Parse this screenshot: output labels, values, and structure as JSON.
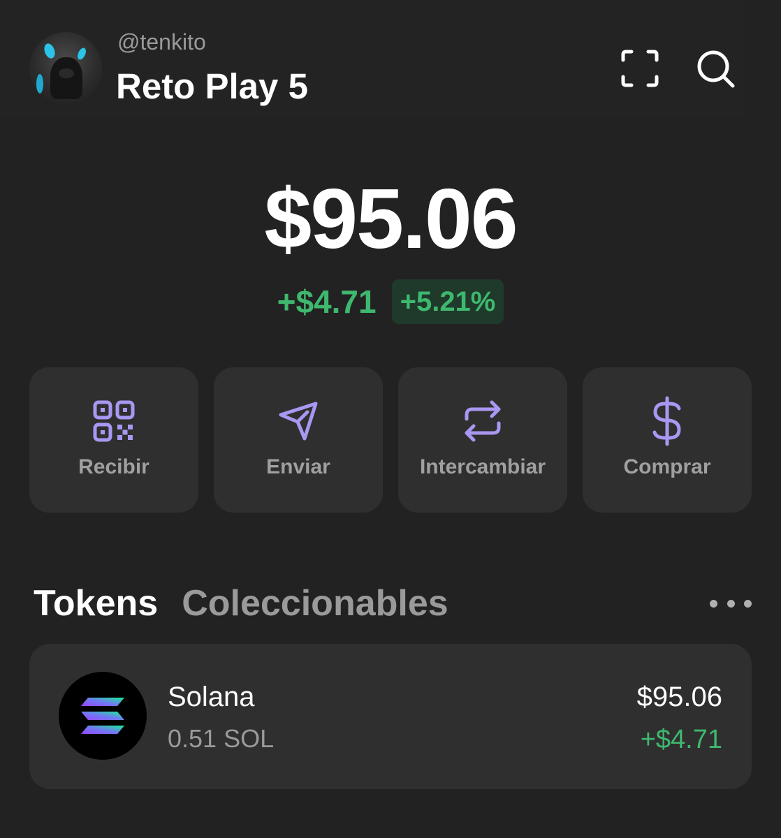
{
  "header": {
    "username": "@tenkito",
    "account_name": "Reto Play 5",
    "scan_icon": "scan-frame-icon",
    "search_icon": "search-icon"
  },
  "balance": {
    "total": "$95.06",
    "change_abs": "+$4.71",
    "change_pct": "+5.21%"
  },
  "actions": [
    {
      "label": "Recibir",
      "icon": "qr-code-icon"
    },
    {
      "label": "Enviar",
      "icon": "send-icon"
    },
    {
      "label": "Intercambiar",
      "icon": "swap-icon"
    },
    {
      "label": "Comprar",
      "icon": "dollar-icon"
    }
  ],
  "tabs": {
    "tokens": "Tokens",
    "collectibles": "Coleccionables",
    "more_icon": "more-horizontal-icon"
  },
  "tokens": [
    {
      "name": "Solana",
      "amount": "0.51 SOL",
      "value": "$95.06",
      "change": "+$4.71",
      "icon": "solana-logo-icon"
    }
  ],
  "colors": {
    "background": "#222222",
    "card": "#2f2f2f",
    "accent": "#a997f2",
    "positive": "#3fb86f",
    "positive_bg": "#1f3a2a",
    "muted_text": "#9a9a9a"
  }
}
